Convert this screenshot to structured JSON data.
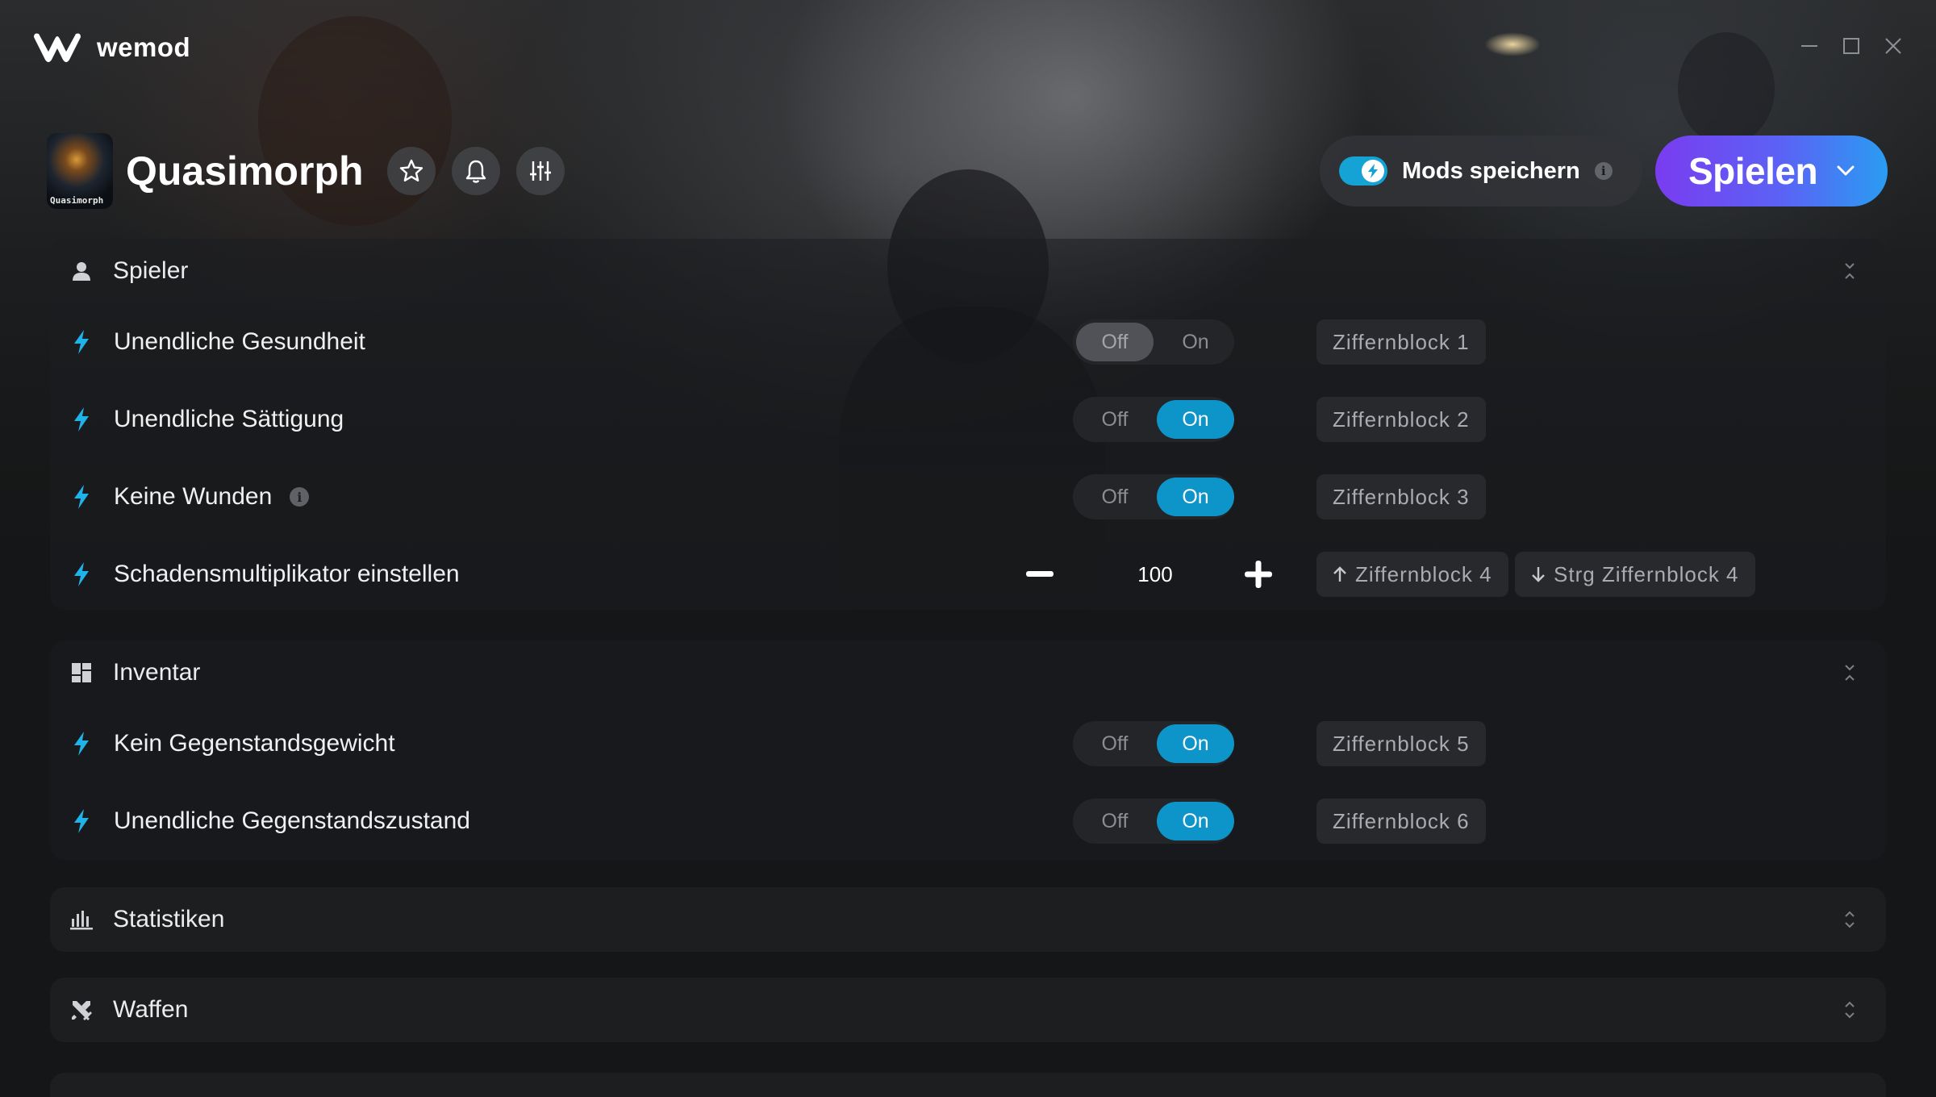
{
  "app": {
    "brand_name": "wemod",
    "window_controls": [
      "minimize-icon",
      "maximize-icon",
      "close-icon"
    ]
  },
  "game": {
    "title": "Quasimorph",
    "thumbnail_label": "Quasimorph",
    "header_icons": [
      "star-icon",
      "bell-icon",
      "sliders-icon"
    ]
  },
  "actions": {
    "save_mods_label": "Mods speichern",
    "save_mods_enabled": true,
    "info_glyph": "i",
    "play_label": "Spielen"
  },
  "switch_labels": {
    "off": "Off",
    "on": "On"
  },
  "sections": {
    "spieler": {
      "title": "Spieler",
      "icon": "person-icon",
      "expanded": true,
      "mods": [
        {
          "label": "Unendliche Gesundheit",
          "state": "Off",
          "hotkey": "Ziffernblock 1"
        },
        {
          "label": "Unendliche Sättigung",
          "state": "On",
          "hotkey": "Ziffernblock 2"
        },
        {
          "label": "Keine Wunden",
          "state": "On",
          "hotkey": "Ziffernblock 3",
          "has_info": true
        },
        {
          "label": "Schadensmultiplikator einstellen",
          "type": "stepper",
          "value": "100",
          "hotkey_up": "Ziffernblock 4",
          "hotkey_down": "Strg Ziffernblock 4"
        }
      ]
    },
    "inventar": {
      "title": "Inventar",
      "icon": "dashboard-icon",
      "expanded": true,
      "mods": [
        {
          "label": "Kein Gegenstandsgewicht",
          "state": "On",
          "hotkey": "Ziffernblock 5"
        },
        {
          "label": "Unendliche Gegenstandszustand",
          "state": "On",
          "hotkey": "Ziffernblock 6"
        }
      ]
    },
    "statistiken": {
      "title": "Statistiken",
      "icon": "bar-chart-icon",
      "expanded": false
    },
    "waffen": {
      "title": "Waffen",
      "icon": "crossed-swords-icon",
      "expanded": false
    }
  },
  "colors": {
    "accent_on": "#0d94c8",
    "play_gradient_start": "#7a3cf0",
    "play_gradient_end": "#2a9cf2",
    "bolt": "#1fb3ea"
  }
}
